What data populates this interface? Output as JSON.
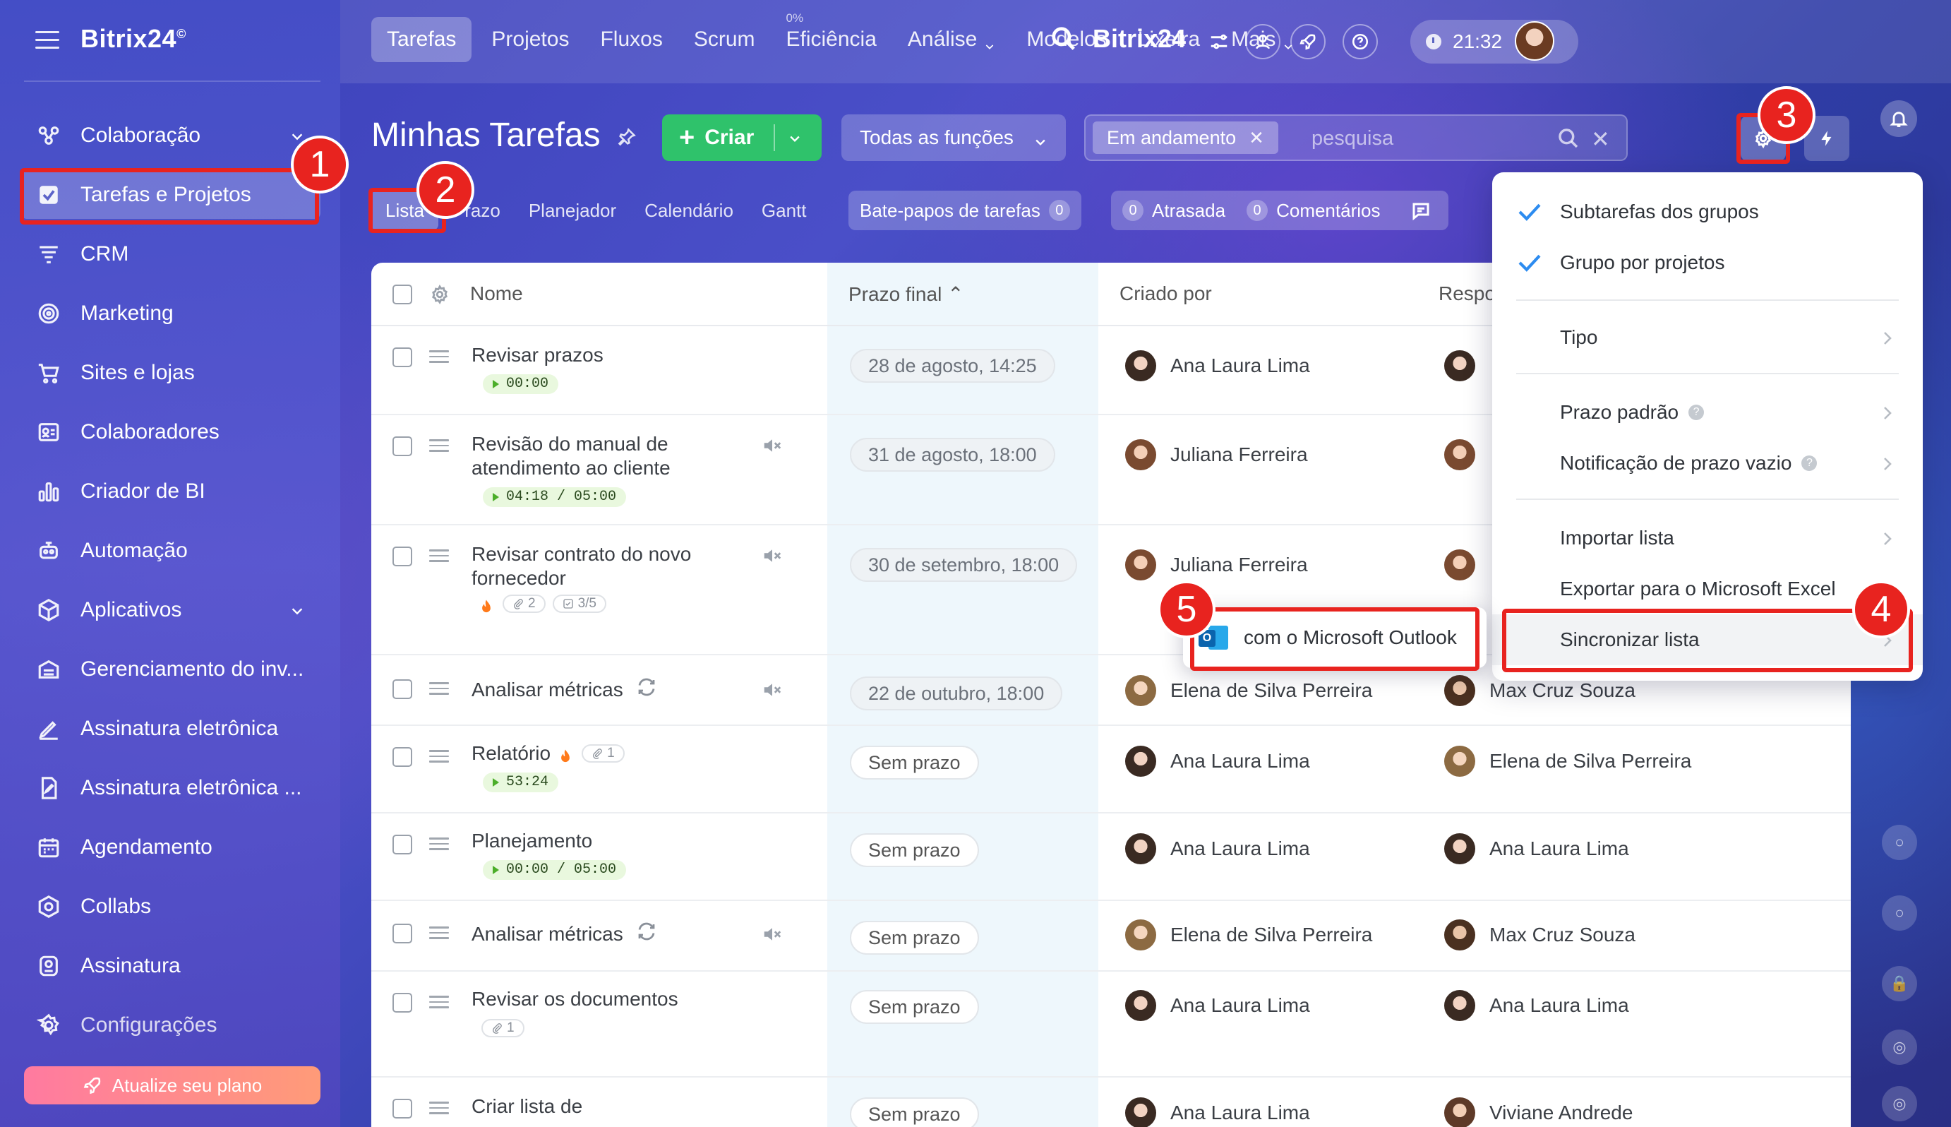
{
  "app": {
    "brand": "Bitrix24",
    "brand_mark": "©"
  },
  "sidebar": {
    "items": [
      {
        "label": "Colaboração",
        "icon": "collaboration-icon",
        "has_chevron": true
      },
      {
        "label": "Tarefas e Projetos",
        "icon": "tasks-icon",
        "active": true
      },
      {
        "label": "CRM",
        "icon": "crm-icon"
      },
      {
        "label": "Marketing",
        "icon": "marketing-icon"
      },
      {
        "label": "Sites e lojas",
        "icon": "cart-icon"
      },
      {
        "label": "Colaboradores",
        "icon": "employees-icon"
      },
      {
        "label": "Criador de BI",
        "icon": "bi-chart-icon"
      },
      {
        "label": "Automação",
        "icon": "automation-icon"
      },
      {
        "label": "Aplicativos",
        "icon": "apps-icon",
        "has_chevron": true
      },
      {
        "label": "Gerenciamento do inv...",
        "icon": "inventory-icon"
      },
      {
        "label": "Assinatura eletrônica",
        "icon": "e-signature-icon"
      },
      {
        "label": "Assinatura eletrônica ...",
        "icon": "e-signature-doc-icon"
      },
      {
        "label": "Agendamento",
        "icon": "calendar-icon"
      },
      {
        "label": "Collabs",
        "icon": "collabs-icon"
      },
      {
        "label": "Assinatura",
        "icon": "subscription-icon"
      },
      {
        "label": "Configurações",
        "icon": "settings-icon"
      }
    ],
    "upgrade_label": "Atualize seu plano"
  },
  "topnav": {
    "items": [
      {
        "label": "Tarefas",
        "active": true
      },
      {
        "label": "Projetos"
      },
      {
        "label": "Fluxos"
      },
      {
        "label": "Scrum"
      },
      {
        "label": "Eficiência",
        "superscript": "0%"
      },
      {
        "label": "Análise",
        "dropdown": true
      },
      {
        "label": "Modelos"
      },
      {
        "label": "Lixeira"
      },
      {
        "label": "Mais",
        "dropdown": true
      }
    ],
    "brand": "Bitrix24",
    "time": "21:32"
  },
  "header": {
    "title": "Minhas Tarefas",
    "create_label": "Criar",
    "roles_label": "Todas as funções",
    "filter_chip": "Em andamento",
    "search_placeholder": "pesquisa"
  },
  "views": {
    "tabs": [
      "Lista",
      "Prazo",
      "Planejador",
      "Calendário",
      "Gantt"
    ],
    "chats_label": "Bate-papos de tarefas",
    "chats_count": "0",
    "overdue_label": "Atrasada",
    "overdue_count": "0",
    "comments_label": "Comentários",
    "comments_count": "0"
  },
  "table": {
    "columns": {
      "name": "Nome",
      "deadline": "Prazo final",
      "created_by": "Criado por",
      "responsible": "Respo"
    },
    "rows": [
      {
        "name": "Revisar prazos",
        "timer": "00:00",
        "deadline": "28 de agosto, 14:25",
        "created_by": "Ana Laura Lima",
        "responsible": ""
      },
      {
        "name": "Revisão do manual de atendimento ao cliente",
        "timer": "04:18 / 05:00",
        "muted": true,
        "deadline": "31 de agosto, 18:00",
        "created_by": "Juliana Ferreira",
        "responsible": ""
      },
      {
        "name": "Revisar contrato do novo fornecedor",
        "hot": true,
        "files": "2",
        "checklist": "3/5",
        "muted": true,
        "deadline": "30 de setembro, 18:00",
        "created_by": "Juliana Ferreira",
        "responsible": ""
      },
      {
        "name": "Analisar métricas",
        "recurring": true,
        "muted": true,
        "deadline": "22 de outubro, 18:00",
        "created_by": "Elena de Silva Perreira",
        "responsible": "Max Cruz Souza"
      },
      {
        "name": "Relatório",
        "hot": true,
        "files": "1",
        "timer": "53:24",
        "deadline": "Sem prazo",
        "created_by": "Ana Laura Lima",
        "responsible": "Elena de Silva Perreira"
      },
      {
        "name": "Planejamento",
        "timer": "00:00 / 05:00",
        "deadline": "Sem prazo",
        "created_by": "Ana Laura Lima",
        "responsible": "Ana Laura Lima"
      },
      {
        "name": "Analisar métricas",
        "recurring": true,
        "muted": true,
        "deadline": "Sem prazo",
        "created_by": "Elena de Silva Perreira",
        "responsible": "Max Cruz Souza"
      },
      {
        "name": "Revisar os documentos",
        "files": "1",
        "deadline": "Sem prazo",
        "created_by": "Ana Laura Lima",
        "responsible": "Ana Laura Lima"
      },
      {
        "name": "Criar lista de",
        "deadline": "Sem prazo",
        "created_by": "Ana Laura Lima",
        "responsible": "Viviane Andrede"
      }
    ]
  },
  "menu": {
    "subtasks_label": "Subtarefas dos grupos",
    "group_label": "Grupo por projetos",
    "type_label": "Tipo",
    "default_deadline_label": "Prazo padrão",
    "empty_deadline_label": "Notificação de prazo vazio",
    "import_label": "Importar lista",
    "export_label": "Exportar para o Microsoft Excel",
    "sync_label": "Sincronizar lista",
    "outlook_label": "com o Microsoft Outlook"
  },
  "annotations": [
    "1",
    "2",
    "3",
    "4",
    "5"
  ],
  "colors": {
    "accent_red": "#e8231f",
    "create_green": "#2fc26b",
    "check_blue": "#2d8cf0"
  }
}
